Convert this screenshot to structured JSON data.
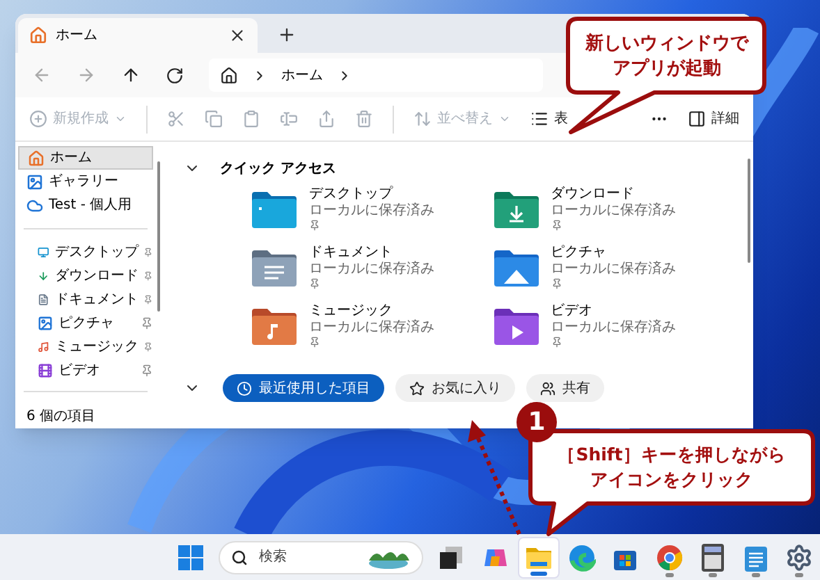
{
  "window": {
    "tabs": [
      {
        "label": "ホーム",
        "selected": true
      }
    ],
    "address": {
      "crumbs": [
        "ホーム"
      ]
    },
    "toolbar": [
      {
        "kind": "new",
        "label": "新規作成",
        "disabled": true
      },
      {
        "kind": "cut",
        "disabled": true
      },
      {
        "kind": "copy",
        "disabled": true
      },
      {
        "kind": "paste",
        "disabled": true
      },
      {
        "kind": "rename",
        "disabled": true
      },
      {
        "kind": "share",
        "disabled": true
      },
      {
        "kind": "delete",
        "disabled": true
      },
      {
        "kind": "sort",
        "label": "並べ替え",
        "disabled": true
      },
      {
        "kind": "view",
        "label": "表",
        "disabled": false
      },
      {
        "kind": "more",
        "disabled": false
      },
      {
        "kind": "details",
        "label": "詳細",
        "disabled": false
      }
    ],
    "sidebar": {
      "top": [
        {
          "kind": "home",
          "label": "ホーム",
          "selected": true
        },
        {
          "kind": "gallery",
          "label": "ギャラリー",
          "selected": false
        },
        {
          "kind": "cloud",
          "label": "Test - 個人用",
          "selected": false
        }
      ],
      "pinned": [
        {
          "kind": "desktop",
          "label": "デスクトップ",
          "pinned": true
        },
        {
          "kind": "downloads",
          "label": "ダウンロード",
          "pinned": true
        },
        {
          "kind": "documents",
          "label": "ドキュメント",
          "pinned": true
        },
        {
          "kind": "pictures",
          "label": "ピクチャ",
          "pinned": true
        },
        {
          "kind": "music",
          "label": "ミュージック",
          "pinned": true
        },
        {
          "kind": "videos",
          "label": "ビデオ",
          "pinned": true
        }
      ]
    },
    "quick_access": {
      "title": "クイック アクセス",
      "expanded": true,
      "items": [
        {
          "kind": "desktop",
          "name": "デスクトップ",
          "status": "ローカルに保存済み",
          "pinned": true
        },
        {
          "kind": "downloads",
          "name": "ダウンロード",
          "status": "ローカルに保存済み",
          "pinned": true
        },
        {
          "kind": "documents",
          "name": "ドキュメント",
          "status": "ローカルに保存済み",
          "pinned": true
        },
        {
          "kind": "pictures",
          "name": "ピクチャ",
          "status": "ローカルに保存済み",
          "pinned": true
        },
        {
          "kind": "music",
          "name": "ミュージック",
          "status": "ローカルに保存済み",
          "pinned": true
        },
        {
          "kind": "videos",
          "name": "ビデオ",
          "status": "ローカルに保存済み",
          "pinned": true
        }
      ]
    },
    "recent_section": {
      "expanded": true,
      "filters": [
        {
          "kind": "recent",
          "label": "最近使用した項目",
          "selected": true
        },
        {
          "kind": "favorites",
          "label": "お気に入り",
          "selected": false
        },
        {
          "kind": "shared",
          "label": "共有",
          "selected": false
        }
      ]
    },
    "status_bar": "6 個の項目"
  },
  "callouts": [
    {
      "lines": [
        "新しいウィンドウで",
        "アプリが起動"
      ]
    },
    {
      "lines": [
        "［Shift］キーを押しながら",
        "アイコンをクリック"
      ],
      "step": "1"
    }
  ],
  "taskbar": {
    "search_placeholder": "検索",
    "apps": [
      {
        "kind": "start",
        "selected": false,
        "running": false
      },
      {
        "kind": "taskview",
        "selected": false,
        "running": false
      },
      {
        "kind": "copilot",
        "selected": false,
        "running": false
      },
      {
        "kind": "explorer",
        "selected": true,
        "running": true
      },
      {
        "kind": "edge",
        "selected": false,
        "running": false
      },
      {
        "kind": "store",
        "selected": false,
        "running": false
      },
      {
        "kind": "chrome",
        "selected": false,
        "running": true
      },
      {
        "kind": "calculator",
        "selected": false,
        "running": true
      },
      {
        "kind": "notepad",
        "selected": false,
        "running": true
      },
      {
        "kind": "settings",
        "selected": false,
        "running": true
      }
    ]
  }
}
